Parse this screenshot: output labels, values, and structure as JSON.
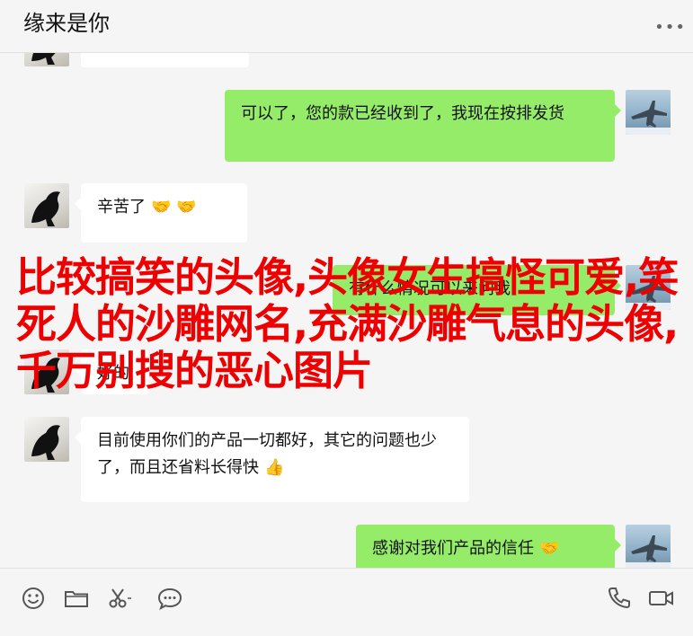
{
  "header": {
    "title": "缘来是你",
    "more_icon": "more-icon"
  },
  "messages": [
    {
      "side": "left",
      "text": ""
    },
    {
      "side": "right",
      "text": "可以了，您的款已经收到了，我现在按排发货"
    },
    {
      "side": "left",
      "text": "辛苦了",
      "emoji": "🤝 🤝"
    },
    {
      "side": "right",
      "text": "有什么情况可以来问我"
    },
    {
      "side": "left",
      "text": "好的"
    },
    {
      "side": "left",
      "text": "目前使用你们的产品一切都好，其它的问题也少了，而且还省料长得快",
      "emoji": "👍"
    },
    {
      "side": "right",
      "text": "感谢对我们产品的信任",
      "emoji": "🤝"
    }
  ],
  "overlay": {
    "text": "比较搞笑的头像,头像女生搞怪可爱,笑死人的沙雕网名,充满沙雕气息的头像,千万别搜的恶心图片",
    "color": "#ee0000"
  },
  "toolbar": {
    "left_icons": [
      "emoji-icon",
      "folder-icon",
      "scissors-icon",
      "chat-bubble-icon"
    ],
    "right_icons": [
      "phone-icon",
      "video-call-icon"
    ]
  }
}
